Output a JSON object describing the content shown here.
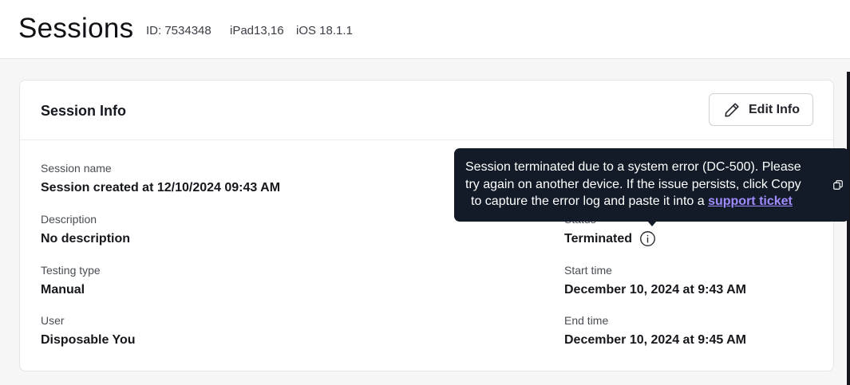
{
  "header": {
    "title": "Sessions",
    "session_id": "ID: 7534348",
    "device": "iPad13,16",
    "os": "iOS 18.1.1"
  },
  "card": {
    "title": "Session Info",
    "edit_button": {
      "label": "Edit Info",
      "icon": "pencil-icon"
    }
  },
  "fields": {
    "session_name": {
      "label": "Session name",
      "value": "Session created at 12/10/2024 09:43 AM"
    },
    "description": {
      "label": "Description",
      "value": "No description"
    },
    "testing_type": {
      "label": "Testing type",
      "value": "Manual"
    },
    "user": {
      "label": "User",
      "value": "Disposable You"
    },
    "status": {
      "label": "Status",
      "value": "Terminated",
      "icon": "info-icon"
    },
    "start_time": {
      "label": "Start time",
      "value": "December 10, 2024 at 9:43 AM"
    },
    "end_time": {
      "label": "End time",
      "value": "December 10, 2024 at 9:45 AM"
    }
  },
  "tooltip": {
    "line1": "Session terminated due to a system error (DC-500). Please",
    "line2": "try again on another device. If the issue persists, click Copy",
    "line3_prefix": "to capture the error log and paste it into a ",
    "link_text": "support ticket",
    "copy_icon": "copy-icon"
  },
  "colors": {
    "tooltip_bg": "#131b28",
    "link": "#a08cff",
    "page_bg": "#f6f6f7"
  }
}
